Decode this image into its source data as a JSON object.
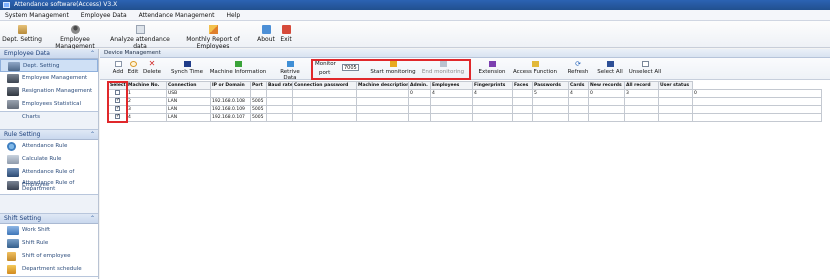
{
  "window": {
    "title": "Attendance software(Access) V3.X"
  },
  "menu": [
    "System Management",
    "Employee Data",
    "Attendance Management",
    "Help"
  ],
  "toolbar": {
    "dept_setting": "Dept. Setting",
    "employee_management": "Employee Management",
    "analyze": "Analyze attendance data",
    "monthly_report": "Monthly Report of Employees",
    "about": "About",
    "exit": "Exit"
  },
  "sidebar": {
    "groups": [
      {
        "title": "Employee Data",
        "items": [
          "Dept. Setting",
          "Employee Management",
          "Resignation Management",
          "Employees Statistical Charts"
        ]
      },
      {
        "title": "Rule Setting",
        "items": [
          "Attendance Rule",
          "Calculate Rule",
          "Attendance Rule of Employee",
          "Attendance Rule of Department"
        ]
      },
      {
        "title": "Shift Setting",
        "items": [
          "Work Shift",
          "Shift Rule",
          "Shift of employee",
          "Department schedule"
        ]
      }
    ]
  },
  "panel": {
    "title": "Device Management"
  },
  "device_toolbar": {
    "add": "Add",
    "edit": "Edit",
    "delete": "Delete",
    "synch_time": "Synch Time",
    "machine_information": "Machine Information",
    "retrive_data": "Retrive Data",
    "monitor_port_line1": "Monitor",
    "monitor_port_line2": "port",
    "monitor_port_value": "7005",
    "start_monitoring": "Start monitoring",
    "end_monitoring": "End monitoring",
    "extension": "Extension",
    "access_function": "Access Function",
    "refresh": "Refresh",
    "select_all": "Select All",
    "unselect_all": "Unselect All"
  },
  "table": {
    "columns": [
      "Select",
      "Machine No.",
      "Connection",
      "IP or Domain",
      "Port",
      "Baud rate",
      "Connection password",
      "Machine description",
      "Admin.",
      "Employees",
      "Fingerprints",
      "Faces",
      "Passwords",
      "Cards",
      "New records",
      "All record",
      "User status"
    ],
    "rows": [
      {
        "selected": false,
        "cells": [
          "1",
          "USB",
          "",
          "",
          "",
          "",
          "",
          "0",
          "4",
          "4",
          "",
          "5",
          "4",
          "0",
          "3",
          "",
          "0"
        ]
      },
      {
        "selected": true,
        "cells": [
          "2",
          "LAN",
          "192.168.0.108",
          "5005",
          "",
          "",
          "",
          "",
          "",
          "",
          "",
          "",
          "",
          "",
          "",
          "",
          ""
        ]
      },
      {
        "selected": true,
        "cells": [
          "3",
          "LAN",
          "192.168.0.109",
          "5005",
          "",
          "",
          "",
          "",
          "",
          "",
          "",
          "",
          "",
          "",
          "",
          "",
          ""
        ]
      },
      {
        "selected": true,
        "cells": [
          "4",
          "LAN",
          "192.168.0.107",
          "5005",
          "",
          "",
          "",
          "",
          "",
          "",
          "",
          "",
          "",
          "",
          "",
          "",
          ""
        ]
      }
    ]
  },
  "colors": {
    "highlight": "#e0282b",
    "title_bar": "#2c63b3",
    "sidebar_head": "#c9d8ee"
  },
  "icons": [
    "dept-setting-icon",
    "employee-management-icon",
    "analyze-icon",
    "report-icon",
    "about-icon",
    "exit-icon",
    "add-icon",
    "edit-icon",
    "delete-icon",
    "sync-icon",
    "machine-info-icon",
    "retrieve-icon",
    "start-monitor-icon",
    "end-monitor-icon",
    "extension-icon",
    "access-icon",
    "refresh-icon",
    "select-all-icon",
    "unselect-all-icon"
  ]
}
